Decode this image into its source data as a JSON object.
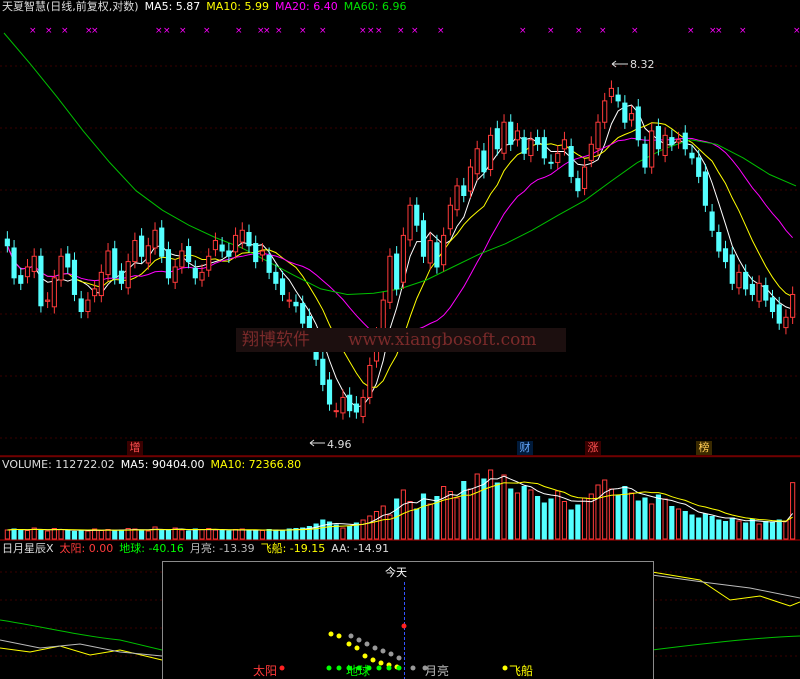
{
  "header": {
    "title": "天夏智慧(日线,前复权,对数)",
    "ma5": "MA5: 5.87",
    "ma10": "MA10: 5.99",
    "ma20": "MA20: 6.40",
    "ma60": "MA60: 6.96"
  },
  "volume_header": {
    "volume": "VOLUME: 112722.02",
    "ma5": "MA5: 90404.00",
    "ma10": "MA10: 72366.80"
  },
  "indicator_header": {
    "name": "日月星辰X",
    "sun": "太阳: 0.00",
    "earth": "地球: -40.16",
    "moon": "月亮: -13.39",
    "ship": "飞船: -19.15",
    "aa": "AA: -14.91"
  },
  "price_annotations": {
    "high": "8.32",
    "low": "4.96"
  },
  "event_tags": {
    "zeng": "增",
    "cai": "财",
    "zhang": "涨",
    "bang": "榜"
  },
  "watermark": {
    "cn": "翔博软件",
    "url": "www.xiangbosoft.com"
  },
  "legend_popup": {
    "today": "今天",
    "sun": "太阳",
    "earth": "地球",
    "moon": "月亮",
    "ship": "飞船"
  },
  "colors": {
    "up": "#ff3b3b",
    "down": "#54ffff",
    "ma5": "#ffffff",
    "ma10": "#ffff00",
    "ma20": "#ff00ff",
    "ma60": "#00c000"
  },
  "chart_data": [
    {
      "type": "candlestick",
      "title": "天夏智慧(日线,前复权,对数)",
      "scale": "log",
      "ylim": [
        4.7,
        9.0
      ],
      "highest_marked": 8.32,
      "lowest_marked": 4.96,
      "series": [
        {
          "name": "MA5",
          "value": 5.87
        },
        {
          "name": "MA10",
          "value": 5.99
        },
        {
          "name": "MA20",
          "value": 6.4
        },
        {
          "name": "MA60",
          "value": 6.96
        }
      ],
      "ma60_path": [
        8.8,
        8.4,
        8.0,
        7.6,
        7.25,
        6.95,
        6.75,
        6.6,
        6.48,
        6.38,
        6.25,
        6.12,
        6.0,
        5.95,
        5.96,
        6.0,
        6.08,
        6.2,
        6.32,
        6.42,
        6.55,
        6.7,
        6.85,
        7.05,
        7.25,
        7.4,
        7.5,
        7.45,
        7.3,
        7.12,
        7.0
      ],
      "closes": [
        6.4,
        6.1,
        6.05,
        6.2,
        6.3,
        5.85,
        5.9,
        6.1,
        6.3,
        6.2,
        5.95,
        5.8,
        5.9,
        6.0,
        6.15,
        6.35,
        6.1,
        6.05,
        6.25,
        6.45,
        6.3,
        6.4,
        6.55,
        6.3,
        6.1,
        6.2,
        6.35,
        6.25,
        6.1,
        6.15,
        6.3,
        6.45,
        6.35,
        6.3,
        6.5,
        6.55,
        6.4,
        6.25,
        6.35,
        6.15,
        6.05,
        5.95,
        5.9,
        5.85,
        5.7,
        5.6,
        5.4,
        5.2,
        5.05,
        5.0,
        5.1,
        5.0,
        4.99,
        5.1,
        5.35,
        5.6,
        5.9,
        6.3,
        6.0,
        6.5,
        6.8,
        6.6,
        6.3,
        6.45,
        6.2,
        6.5,
        6.8,
        7.0,
        6.9,
        7.2,
        7.4,
        7.15,
        7.55,
        7.4,
        7.7,
        7.45,
        7.6,
        7.35,
        7.5,
        7.45,
        7.3,
        7.25,
        7.35,
        7.5,
        7.1,
        6.95,
        7.2,
        7.45,
        7.7,
        7.95,
        8.1,
        7.95,
        7.7,
        7.8,
        7.5,
        7.2,
        7.6,
        7.4,
        7.55,
        7.45,
        7.5,
        7.4,
        7.3,
        7.1,
        6.8,
        6.55,
        6.35,
        6.25,
        6.05,
        6.15,
        6.0,
        5.95,
        6.05,
        5.9,
        5.8,
        5.7,
        5.75,
        5.95
      ]
    },
    {
      "type": "bar",
      "title": "VOLUME",
      "series": [
        {
          "name": "VOLUME",
          "value": 112722.02
        },
        {
          "name": "MA5",
          "value": 90404.0
        },
        {
          "name": "MA10",
          "value": 72366.8
        }
      ],
      "values": [
        18000,
        20000,
        19000,
        17000,
        22000,
        18000,
        16000,
        21000,
        19000,
        17000,
        15000,
        18000,
        16000,
        20000,
        17000,
        19000,
        16000,
        18000,
        21000,
        20000,
        17000,
        16000,
        24000,
        19000,
        17000,
        22000,
        18000,
        16000,
        20000,
        19000,
        21000,
        18000,
        17000,
        16000,
        19000,
        20000,
        18000,
        16000,
        17000,
        19000,
        18000,
        17000,
        20000,
        21000,
        22000,
        25000,
        30000,
        38000,
        34000,
        28000,
        22000,
        26000,
        32000,
        38000,
        46000,
        55000,
        66000,
        48000,
        80000,
        98000,
        75000,
        60000,
        90000,
        70000,
        85000,
        105000,
        95000,
        82000,
        115000,
        100000,
        130000,
        120000,
        138000,
        112000,
        128000,
        100000,
        92000,
        105000,
        98000,
        85000,
        72000,
        80000,
        96000,
        75000,
        58000,
        68000,
        82000,
        90000,
        108000,
        118000,
        100000,
        88000,
        105000,
        92000,
        76000,
        82000,
        70000,
        88000,
        80000,
        65000,
        60000,
        55000,
        48000,
        42000,
        50000,
        45000,
        38000,
        35000,
        42000,
        36000,
        32000,
        40000,
        30000,
        35000,
        34000,
        38000,
        36000,
        112722
      ]
    },
    {
      "type": "line",
      "title": "日月星辰X",
      "series": [
        {
          "name": "太阳",
          "value": 0.0
        },
        {
          "name": "地球",
          "value": -40.16
        },
        {
          "name": "月亮",
          "value": -13.39
        },
        {
          "name": "飞船",
          "value": -19.15
        },
        {
          "name": "AA",
          "value": -14.91
        }
      ]
    }
  ]
}
